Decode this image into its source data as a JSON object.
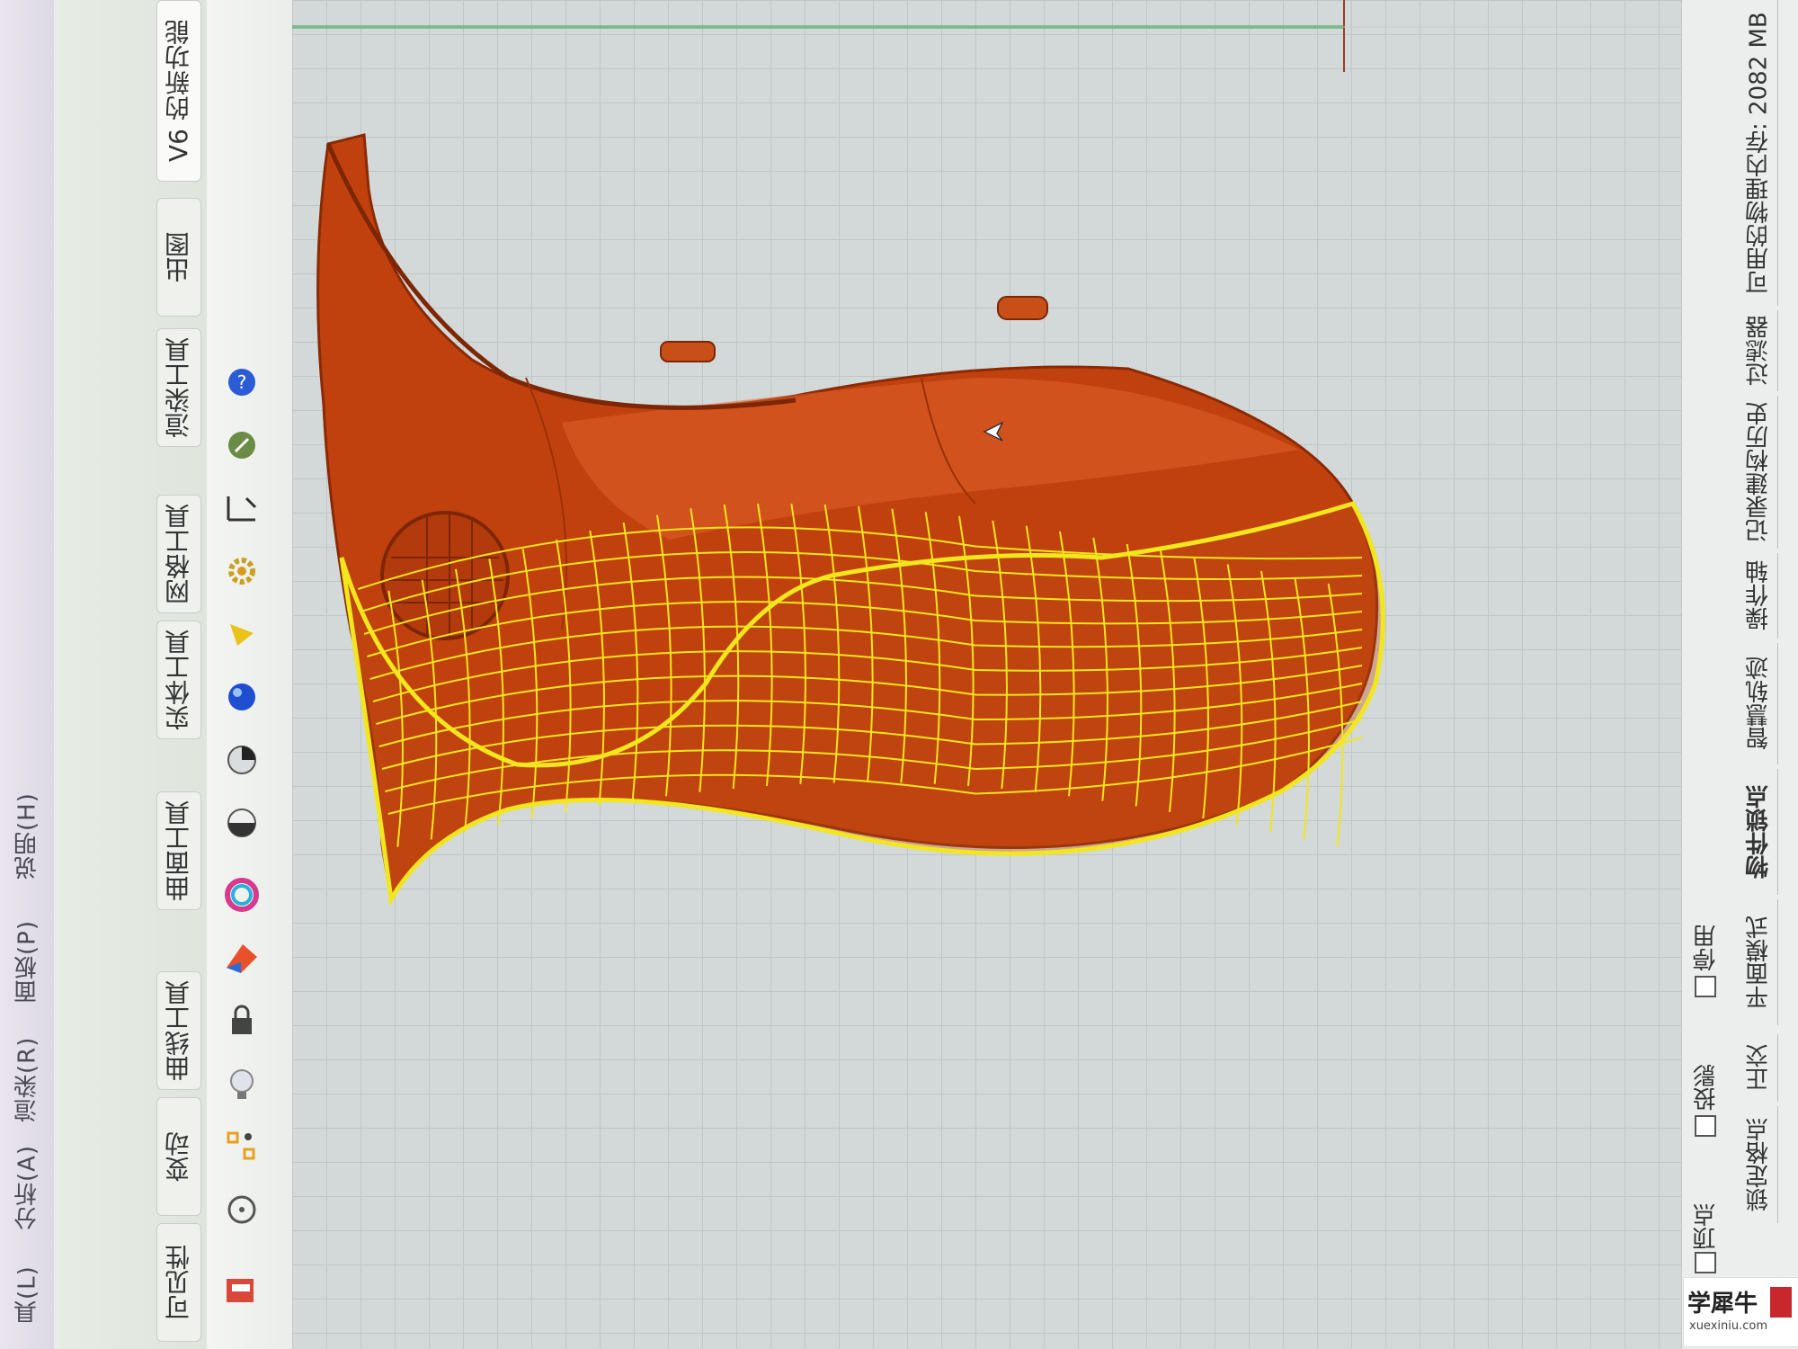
{
  "menu": {
    "items": [
      {
        "label": "具(L)"
      },
      {
        "label": "分析(A)"
      },
      {
        "label": "渲染(R)"
      },
      {
        "label": "面板(P)"
      },
      {
        "label": "说明(H)"
      }
    ]
  },
  "tabs": [
    {
      "label": "可见性"
    },
    {
      "label": "变动"
    },
    {
      "label": "曲线工具"
    },
    {
      "label": "曲面工具"
    },
    {
      "label": "实体工具"
    },
    {
      "label": "网格工具"
    },
    {
      "label": "渲染工具"
    },
    {
      "label": "出图"
    },
    {
      "label": "V6 的新功能"
    }
  ],
  "toolbar_icons": [
    {
      "icon": "render-icon"
    },
    {
      "icon": "circle-point-icon"
    },
    {
      "icon": "snap-points-icon"
    },
    {
      "icon": "light-bulb-icon"
    },
    {
      "icon": "lock-icon"
    },
    {
      "icon": "surface-material-icon"
    },
    {
      "icon": "color-wheel-icon"
    },
    {
      "icon": "sphere-half-icon"
    },
    {
      "icon": "sphere-quarter-icon"
    },
    {
      "icon": "blue-sphere-icon"
    },
    {
      "icon": "triangle-flag-icon"
    },
    {
      "icon": "gear-settings-icon"
    },
    {
      "icon": "dimension-icon"
    },
    {
      "icon": "globe-arrow-icon"
    },
    {
      "icon": "help-icon"
    }
  ],
  "status_bar": {
    "osnap_items": [
      {
        "label": "点"
      },
      {
        "label": "顶点"
      },
      {
        "label": "投影"
      },
      {
        "label": "停用"
      }
    ],
    "tabs": [
      {
        "label": "锁定格点"
      },
      {
        "label": "正交"
      },
      {
        "label": "平面模式"
      },
      {
        "label": "物件锁点"
      },
      {
        "label": "智慧轨迹"
      },
      {
        "label": "操作轴"
      },
      {
        "label": "记录建构历史"
      },
      {
        "label": "过滤器"
      },
      {
        "label": "可用的物理内存: 2082 MB"
      }
    ]
  },
  "watermark": {
    "main": "学犀牛",
    "sub": "xuexiniu.com"
  },
  "colors": {
    "surface": "#c1410e",
    "surface_light": "#e0612a",
    "edge": "#8a2a05",
    "selected_wire": "#f2e61c",
    "grid": "#bfc6c6",
    "viewport_bg": "#d3d9d9",
    "axis_green": "#3aa24a"
  }
}
